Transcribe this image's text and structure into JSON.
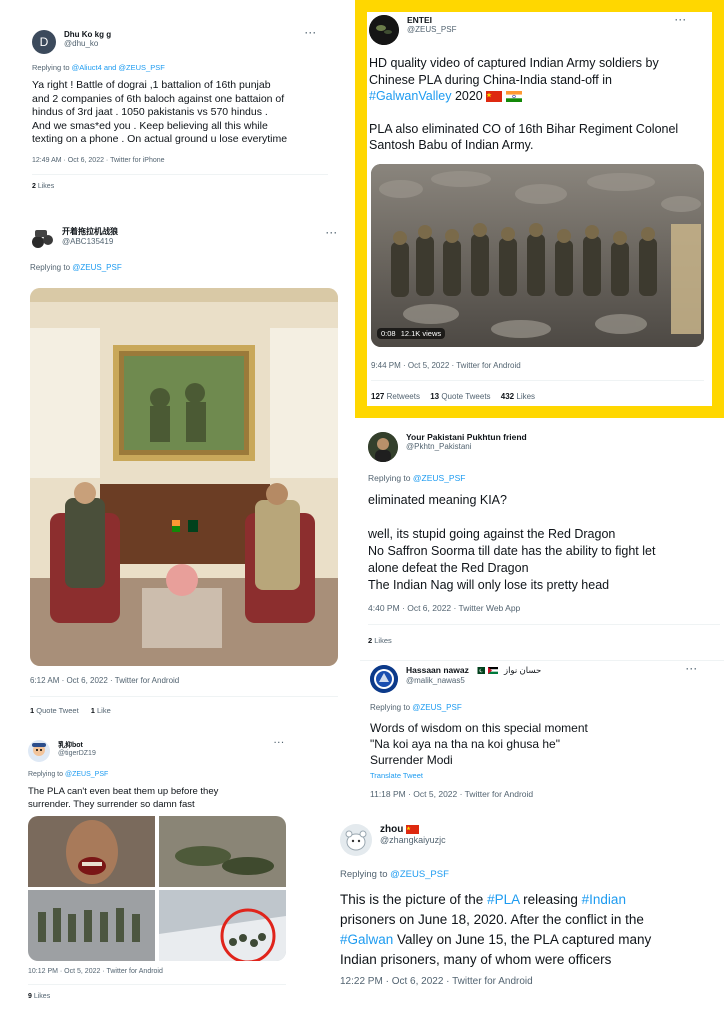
{
  "tweets": {
    "t1": {
      "name": "Dhu Ko kg g",
      "handle": "@dhu_ko",
      "avatar_letter": "D",
      "replying_prefix": "Replying to",
      "replying_to": "@Aliuct4 and @ZEUS_PSF",
      "text_lines": [
        "Ya right ! Battle of dograi ,1 battalion of 16th punjab",
        "and 2 companies of 6th baloch against one battaion of",
        "hindus of 3rd jaat . 1050 pakistanis vs 570 hindus .",
        "And we smas*ed you . Keep believing all this while",
        "texting on a phone . On actual ground u lose everytime"
      ],
      "meta": "12:49 AM · Oct 6, 2022 · Twitter for iPhone",
      "likes_count": "2",
      "likes_label": "Likes",
      "more": "···"
    },
    "t2": {
      "name": "ENTEI",
      "handle": "@ZEUS_PSF",
      "line1": "HD quality video of captured Indian Army soldiers by",
      "line2": "Chinese PLA during China-India stand-off in",
      "hashtag": "#GalwanValley",
      "year": "2020",
      "para2_line1": "PLA also eliminated CO of 16th Bihar Regiment Colonel",
      "para2_line2": "Santosh Babu of Indian Army.",
      "video_time": "0:08",
      "video_views": "12.1K views",
      "meta": "9:44 PM · Oct 5, 2022 · Twitter for Android",
      "retweets_count": "127",
      "retweets_label": "Retweets",
      "quotes_count": "13",
      "quotes_label": "Quote Tweets",
      "likes_count": "432",
      "likes_label": "Likes",
      "highlight_color": "#ffd700",
      "more": "···"
    },
    "t3": {
      "name": "开着拖拉机战狼",
      "handle": "@ABC135419",
      "replying_prefix": "Replying to",
      "replying_to": "@ZEUS_PSF",
      "meta": "6:12 AM · Oct 6, 2022 · Twitter for Android",
      "quotes_count": "1",
      "quotes_label": "Quote Tweet",
      "likes_count": "1",
      "likes_label": "Like",
      "more": "···"
    },
    "t4": {
      "name": "Your Pakistani Pukhtun friend",
      "handle": "@Pkhtn_Pakistani",
      "replying_prefix": "Replying to",
      "replying_to": "@ZEUS_PSF",
      "text_lines": [
        "eliminated meaning KIA?",
        "",
        "well, its stupid going against the Red Dragon",
        "No Saffron Soorma till date has the ability to fight let",
        "alone defeat the Red Dragon",
        "The Indian Nag will only lose its pretty head"
      ],
      "meta": "4:40 PM · Oct 6, 2022 · Twitter Web App",
      "likes_count": "2",
      "likes_label": "Likes"
    },
    "t5": {
      "name": "Hassaan nawaz",
      "urdu_name": "حسان نواز",
      "handle": "@malik_nawas5",
      "replying_prefix": "Replying to",
      "replying_to": "@ZEUS_PSF",
      "text_lines": [
        "Words of wisdom on this special moment",
        "\"Na koi aya na tha na koi ghusa he\"",
        "Surrender Modi"
      ],
      "translate": "Translate Tweet",
      "meta": "11:18 PM · Oct 5, 2022 · Twitter for Android",
      "more": "···"
    },
    "t6": {
      "name": "乳抑bot",
      "handle": "@tigerDZ19",
      "replying_prefix": "Replying to",
      "replying_to": "@ZEUS_PSF",
      "text_lines": [
        "The PLA can't even beat them up before they",
        "surrender. They surrender so damn fast"
      ],
      "meta": "10:12 PM · Oct 5, 2022 · Twitter for Android",
      "likes_count": "9",
      "likes_label": "Likes",
      "more": "···"
    },
    "t7": {
      "name": "zhou",
      "handle": "@zhangkaiyuzjc",
      "replying_prefix": "Replying to",
      "replying_to": "@ZEUS_PSF",
      "seg1": "This is the picture of the ",
      "tag_pla": "#PLA",
      "seg2": " releasing ",
      "tag_indian": "#Indian",
      "seg3": "prisoners on June 18, 2020. After the conflict in the",
      "tag_galwan": "#Galwan",
      "seg4": " Valley on June 15, the PLA captured many",
      "seg5": "Indian prisoners, many of whom were officers",
      "meta": "12:22 PM · Oct 6, 2022 · Twitter for Android"
    }
  },
  "colors": {
    "link": "#1d9bf0",
    "secondary_text": "#536471",
    "highlight_border": "#ffd700"
  }
}
